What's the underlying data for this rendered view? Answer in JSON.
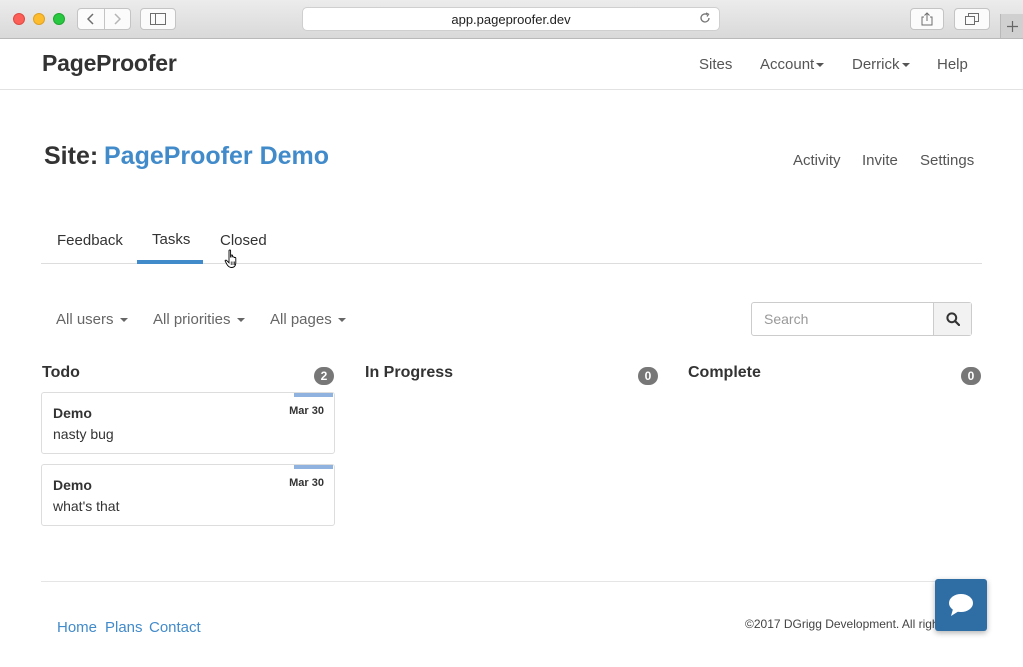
{
  "browser": {
    "url": "app.pageproofer.dev"
  },
  "navbar": {
    "brand": "PageProofer",
    "items": [
      {
        "label": "Sites"
      },
      {
        "label": "Account"
      },
      {
        "label": "Derrick"
      },
      {
        "label": "Help"
      }
    ]
  },
  "site": {
    "label": "Site:",
    "name": "PageProofer Demo",
    "links": [
      "Activity",
      "Invite",
      "Settings"
    ]
  },
  "tabs": [
    {
      "label": "Feedback",
      "active": false
    },
    {
      "label": "Tasks",
      "active": true
    },
    {
      "label": "Closed",
      "active": false
    }
  ],
  "filters": {
    "users": "All users",
    "priorities": "All priorities",
    "pages": "All pages",
    "search_placeholder": "Search"
  },
  "columns": [
    {
      "title": "Todo",
      "count": "2",
      "cards": [
        {
          "site": "Demo",
          "date": "Mar 30",
          "text": "nasty bug"
        },
        {
          "site": "Demo",
          "date": "Mar 30",
          "text": "what's that"
        }
      ]
    },
    {
      "title": "In Progress",
      "count": "0",
      "cards": []
    },
    {
      "title": "Complete",
      "count": "0",
      "cards": []
    }
  ],
  "footer": {
    "links": [
      "Home",
      "Plans",
      "Contact"
    ],
    "copyright": "©2017 DGrigg Development. All rights"
  },
  "colors": {
    "accent": "#428bca",
    "badge": "#777777",
    "chat_button": "#2f6da5",
    "card_bar": "#8fb3de"
  },
  "icons": [
    "back-icon",
    "forward-icon",
    "sidebar-icon",
    "reload-icon",
    "share-icon",
    "tabs-icon",
    "plus-icon",
    "search-icon",
    "chat-icon",
    "hand-cursor-icon"
  ]
}
